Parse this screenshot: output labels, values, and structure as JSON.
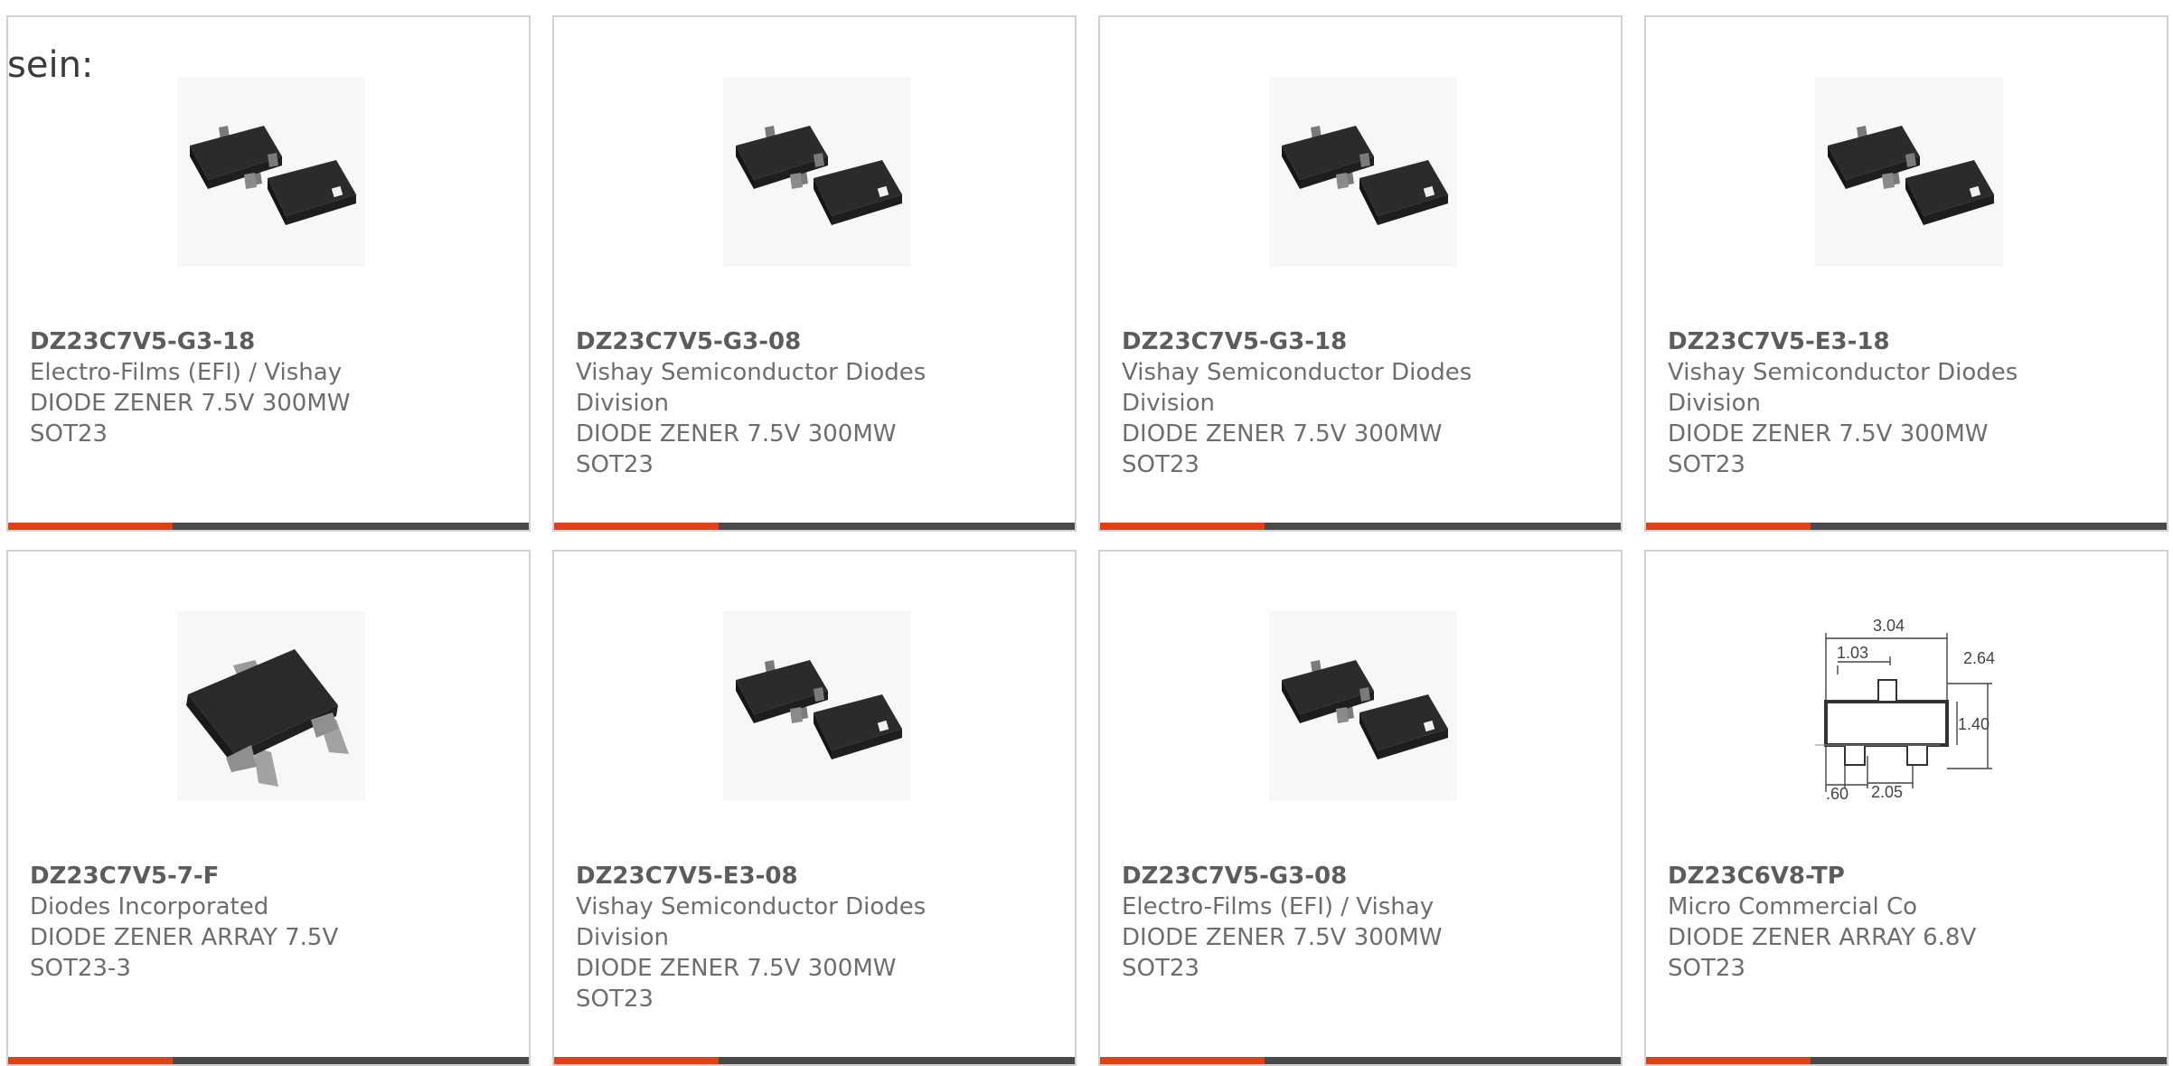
{
  "intro_text": "sein:",
  "colors": {
    "accent_bar": "#e04018",
    "bar_base": "#4a4a4a",
    "card_border": "#d2d2d2",
    "text": "#6d6d6d"
  },
  "cards": [
    {
      "part_number": "DZ23C7V5-G3-18",
      "lines": [
        "Electro-Films (EFI) / Vishay",
        "DIODE ZENER 7.5V 300MW",
        "SOT23"
      ],
      "image": "sot23-dual-chip"
    },
    {
      "part_number": "DZ23C7V5-G3-08",
      "lines": [
        "Vishay Semiconductor Diodes",
        "Division",
        "DIODE ZENER 7.5V 300MW",
        "SOT23"
      ],
      "image": "sot23-dual-chip"
    },
    {
      "part_number": "DZ23C7V5-G3-18",
      "lines": [
        "Vishay Semiconductor Diodes",
        "Division",
        "DIODE ZENER 7.5V 300MW",
        "SOT23"
      ],
      "image": "sot23-dual-chip"
    },
    {
      "part_number": "DZ23C7V5-E3-18",
      "lines": [
        "Vishay Semiconductor Diodes",
        "Division",
        "DIODE ZENER 7.5V 300MW",
        "SOT23"
      ],
      "image": "sot23-dual-chip"
    },
    {
      "part_number": "DZ23C7V5-7-F",
      "lines": [
        "Diodes Incorporated",
        "DIODE ZENER ARRAY 7.5V",
        "SOT23-3"
      ],
      "image": "sot23-3-chip"
    },
    {
      "part_number": "DZ23C7V5-E3-08",
      "lines": [
        "Vishay Semiconductor Diodes",
        "Division",
        "DIODE ZENER 7.5V 300MW",
        "SOT23"
      ],
      "image": "sot23-dual-chip"
    },
    {
      "part_number": "DZ23C7V5-G3-08",
      "lines": [
        "Electro-Films (EFI) / Vishay",
        "DIODE ZENER 7.5V 300MW",
        "SOT23"
      ],
      "image": "sot23-dual-chip"
    },
    {
      "part_number": "DZ23C6V8-TP",
      "lines": [
        "Micro Commercial Co",
        "DIODE ZENER ARRAY 6.8V",
        "SOT23"
      ],
      "image": "sot23-dimension-drawing",
      "drawing_labels": [
        "3.04",
        "1.03",
        "2.64",
        "1.40",
        ".60",
        "2.05"
      ]
    }
  ]
}
